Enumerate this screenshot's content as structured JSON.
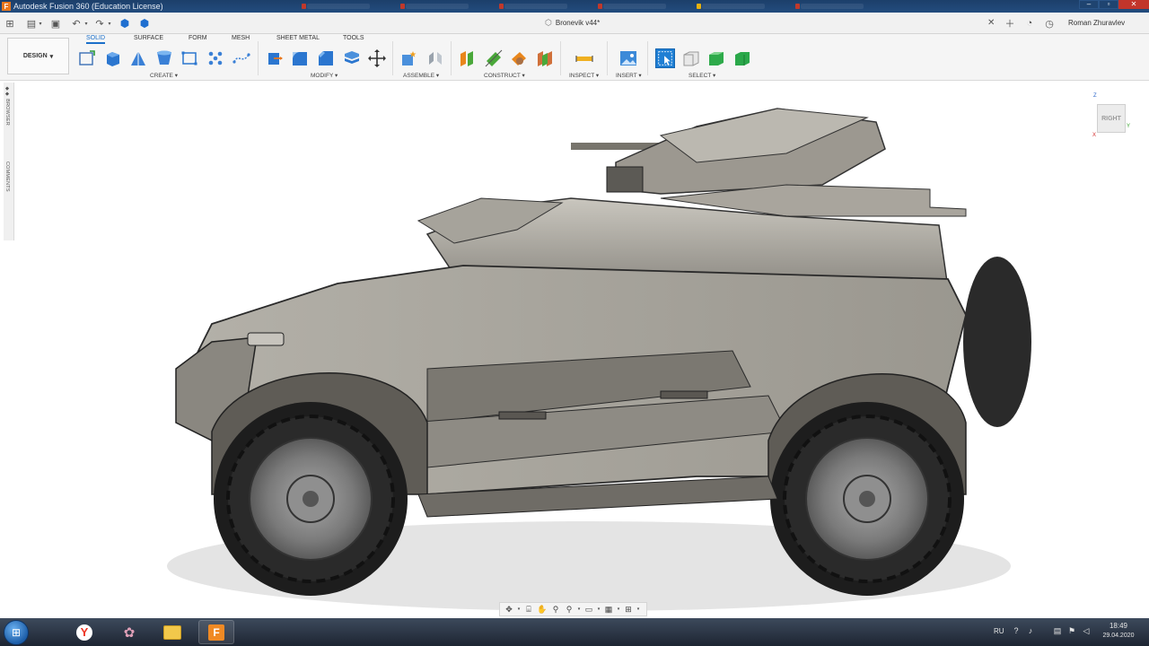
{
  "window": {
    "title": "Autodesk Fusion 360 (Education License)",
    "app_icon": "F"
  },
  "document": {
    "tab_title": "Bronevik v44*"
  },
  "user": {
    "name": "Roman Zhuravlev"
  },
  "workspace": {
    "label": "DESIGN"
  },
  "ribbon_tabs": [
    "SOLID",
    "SURFACE",
    "FORM",
    "MESH",
    "SHEET METAL",
    "TOOLS"
  ],
  "ribbon_groups": {
    "create": "CREATE",
    "modify": "MODIFY",
    "assemble": "ASSEMBLE",
    "construct": "CONSTRUCT",
    "inspect": "INSPECT",
    "insert": "INSERT",
    "select": "SELECT"
  },
  "side_panel": {
    "browser": "BROWSER",
    "comments": "COMMENTS"
  },
  "viewcube": {
    "face": "RIGHT",
    "axes": {
      "z": "Z",
      "y": "Y",
      "x": "X"
    }
  },
  "taskbar": {
    "language": "RU",
    "time": "18:49",
    "date": "29.04.2020"
  },
  "colors": {
    "accent": "#1b6fc9",
    "titlebar": "#234c7e",
    "taskbar": "#2b3443"
  }
}
